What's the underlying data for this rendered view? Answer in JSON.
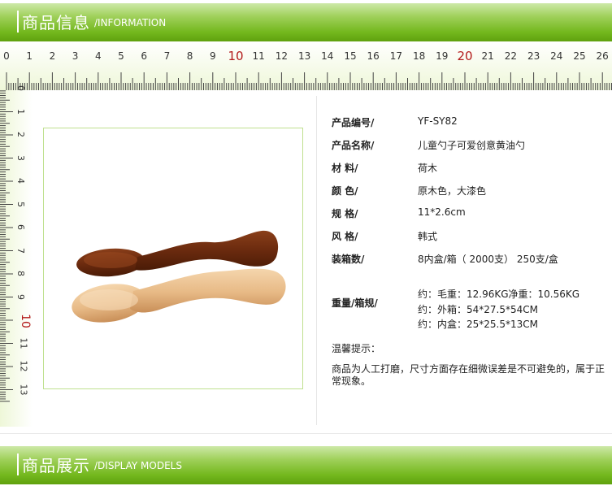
{
  "header": {
    "title_cn": "商品信息",
    "title_en": "/INFORMATION"
  },
  "ruler_top": {
    "labels": [
      "0",
      "1",
      "2",
      "3",
      "4",
      "5",
      "6",
      "7",
      "8",
      "9",
      "10",
      "11",
      "12",
      "13",
      "14",
      "15",
      "16",
      "17",
      "18",
      "19",
      "20",
      "21",
      "22",
      "23",
      "24",
      "25",
      "26"
    ],
    "highlight": [
      "10",
      "20"
    ]
  },
  "ruler_left": {
    "labels": [
      "0",
      "1",
      "2",
      "3",
      "4",
      "5",
      "6",
      "7",
      "8",
      "9",
      "10",
      "11",
      "12",
      "13"
    ],
    "highlight": [
      "10"
    ]
  },
  "specs": [
    {
      "label": "产品编号/",
      "value": "YF-SY82"
    },
    {
      "label": "产品名称/",
      "value": "儿童勺子可爱创意黄油勺"
    },
    {
      "label": "材  料/",
      "value": "荷木"
    },
    {
      "label": "颜  色/",
      "value": "原木色，大漆色"
    },
    {
      "label": "规  格/",
      "value": "11*2.6cm"
    },
    {
      "label": "风  格/",
      "value": "韩式"
    },
    {
      "label": "装箱数/",
      "value": "8内盒/箱（ 2000支） 250支/盒"
    }
  ],
  "weight": {
    "label": "重量/箱规/",
    "lines": [
      "约：毛重：12.96KG净重：10.56KG",
      "约：外箱：54*27.5*54CM",
      "约：内盒：25*25.5*13CM"
    ]
  },
  "note": {
    "title": "温馨提示：",
    "body": "商品为人工打磨，尺寸方面存在细微误差是不可避免的，属于正常现象。"
  },
  "footer": {
    "title_cn": "商品展示",
    "title_en": "/DISPLAY MODELS"
  },
  "colors": {
    "banner_green": "#74b81e",
    "ruler_red": "#b31b1b",
    "frame_green": "#bfe08f"
  }
}
